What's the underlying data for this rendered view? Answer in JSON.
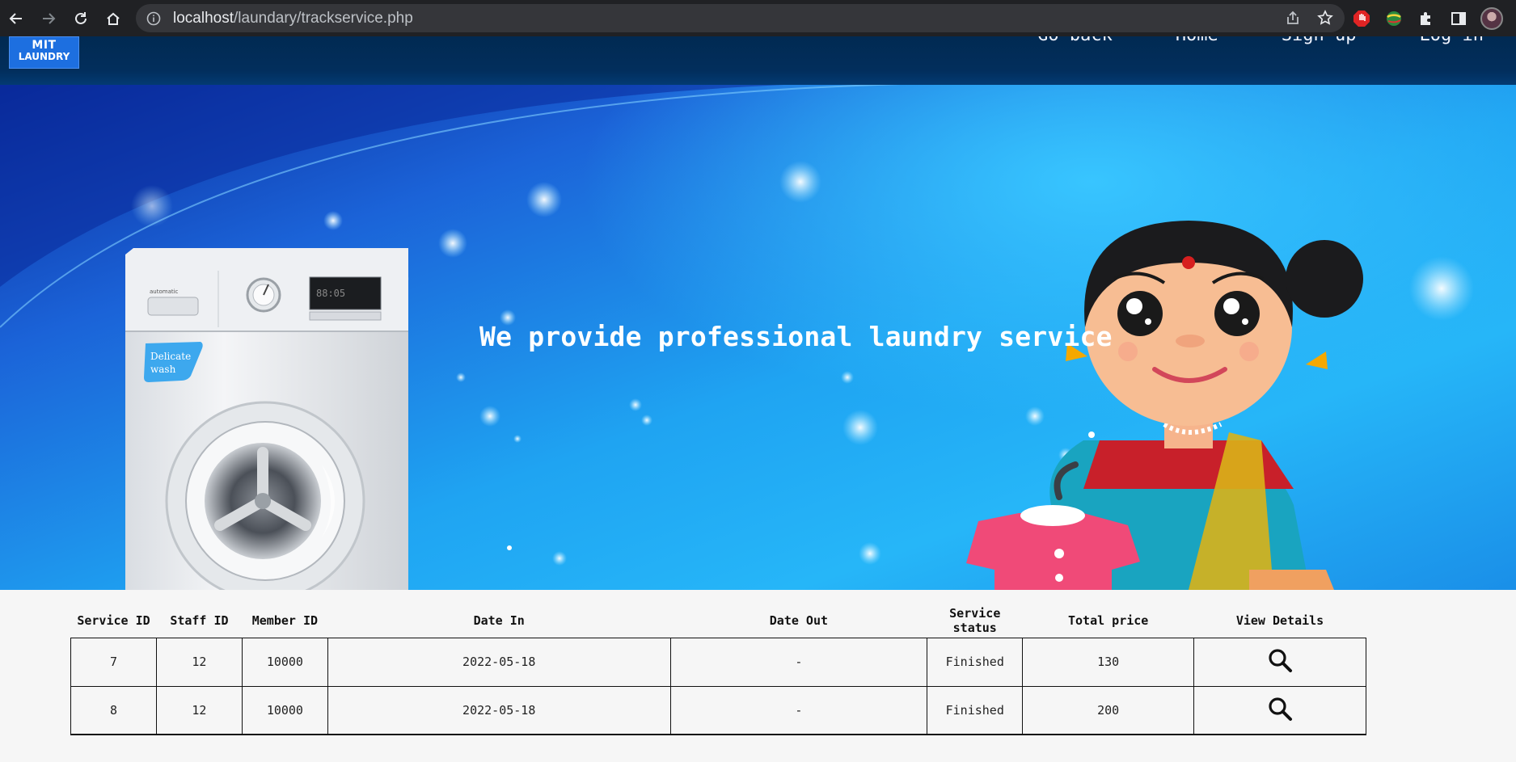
{
  "browser": {
    "url_host": "localhost",
    "url_path": "/laundary/trackservice.php"
  },
  "site": {
    "logo_line1": "MIT",
    "logo_line2": "LAUNDRY",
    "nav": [
      "Go back",
      "Home",
      "Sign up",
      "Log in"
    ]
  },
  "hero": {
    "title": "We provide professional laundry service",
    "sticker_line1": "Delicate",
    "sticker_line2": "wash",
    "brand_text": "automatic",
    "display_text": "88:05"
  },
  "table": {
    "headers": [
      "Service ID",
      "Staff ID",
      "Member ID",
      "Date In",
      "Date Out",
      "Service status",
      "Total price",
      "View Details"
    ],
    "rows": [
      [
        "7",
        "12",
        "10000",
        "2022-05-18",
        "-",
        "Finished",
        "130"
      ],
      [
        "8",
        "12",
        "10000",
        "2022-05-18",
        "-",
        "Finished",
        "200"
      ]
    ]
  },
  "colors": {
    "header_bg": "#022e5c",
    "logo_bg": "#1d6fe0",
    "hero_blue": "#1fa4f2"
  }
}
